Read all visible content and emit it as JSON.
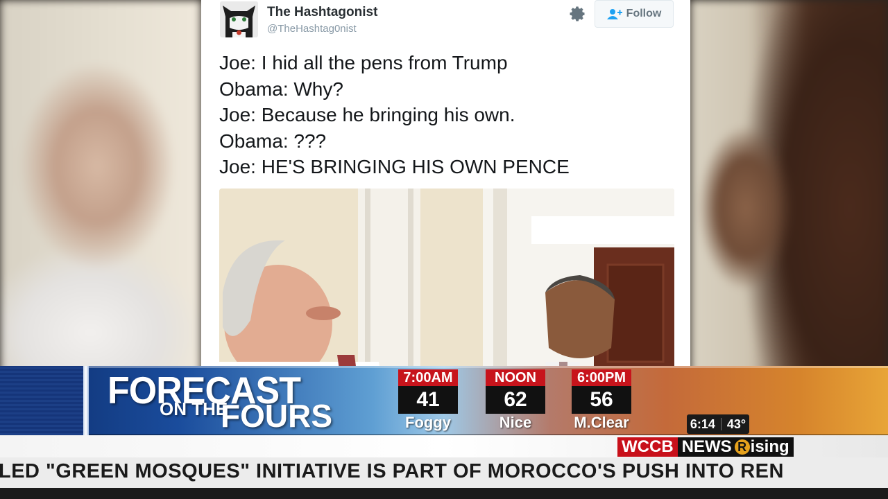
{
  "tweet": {
    "author_name": "The Hashtagonist",
    "author_handle": "@TheHashtag0nist",
    "follow_label": "Follow",
    "lines": [
      "Joe: I hid all the pens from Trump",
      "Obama: Why?",
      "Joe: Because he bringing his own.",
      "Obama: ???",
      "Joe: HE'S BRINGING HIS OWN PENCE"
    ]
  },
  "forecast": {
    "line1": "FORECAST",
    "line2": "ON THE",
    "line3": "FOURS",
    "slots": [
      {
        "time": "7:00AM",
        "temp": "41",
        "condition": "Foggy"
      },
      {
        "time": "NOON",
        "temp": "62",
        "condition": "Nice"
      },
      {
        "time": "6:00PM",
        "temp": "56",
        "condition": "M.Clear"
      }
    ]
  },
  "clock": {
    "time": "6:14",
    "temp": "43°"
  },
  "brand": {
    "station": "WCCB",
    "news": "NEWS",
    "rising_r": "R",
    "rising_rest": "ising"
  },
  "ticker": {
    "text": "LED \"GREEN MOSQUES\" INITIATIVE IS PART OF MOROCCO'S PUSH INTO REN"
  },
  "colors": {
    "brand_red": "#c8101a",
    "twitter_blue": "#1da1f2"
  }
}
